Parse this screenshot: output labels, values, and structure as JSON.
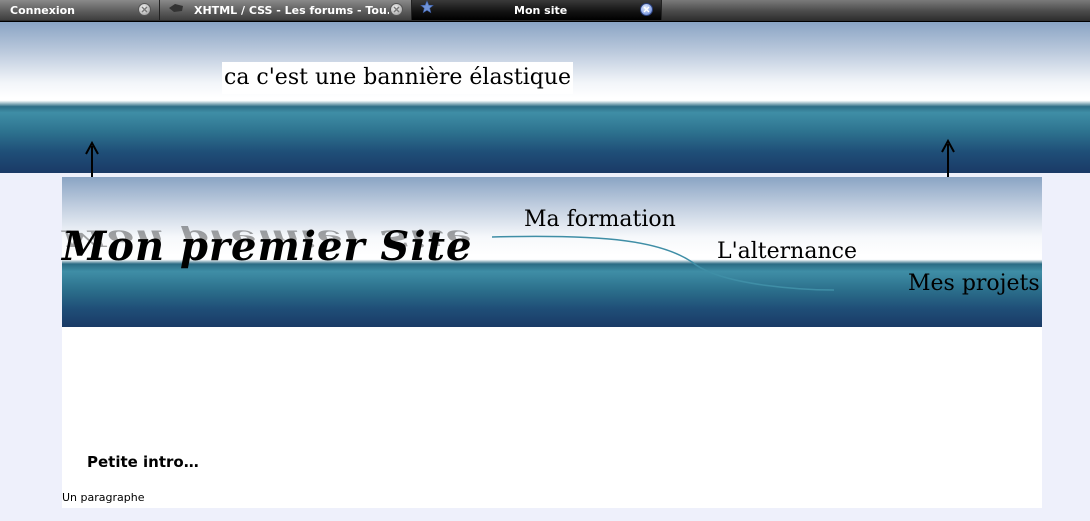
{
  "browser": {
    "tabs": [
      {
        "label": "Connexion",
        "active": false
      },
      {
        "label": "XHTML / CSS - Les forums - Tou...",
        "active": false
      },
      {
        "label": "Mon site",
        "active": true
      }
    ]
  },
  "banner": {
    "caption": "ca c'est une bannière élastique"
  },
  "header": {
    "site_title": "Mon premier Site",
    "nav": {
      "formation": "Ma formation",
      "alternance": "L'alternance",
      "projets": "Mes projets"
    }
  },
  "content": {
    "intro_heading": "Petite intro…",
    "paragraph": "Un paragraphe"
  },
  "colors": {
    "tab_bar": "#4a4a4a",
    "banner_top": "#8aa4c4",
    "banner_band": "#3f8ea6",
    "banner_bottom": "#1a3a66",
    "page_background": "#eef0fb"
  },
  "icons": {
    "tab_close": "close-circle-icon",
    "tab_favicon_forum": "forum-favicon-icon",
    "tab_favicon_site": "star-icon"
  }
}
